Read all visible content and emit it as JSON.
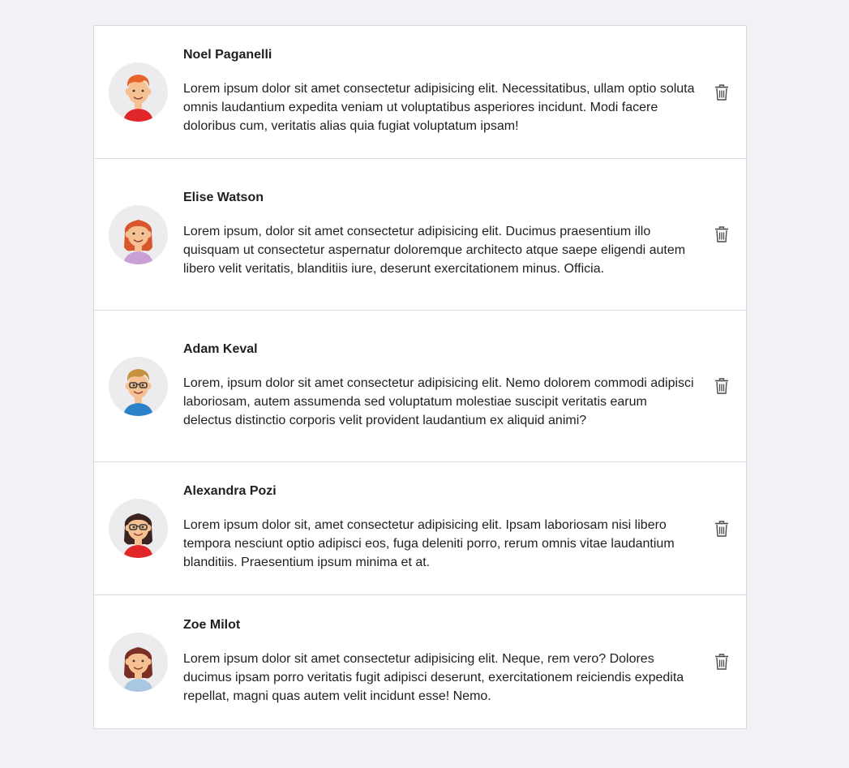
{
  "comments": [
    {
      "author": "Noel Paganelli",
      "text": "Lorem ipsum dolor sit amet consectetur adipisicing elit. Necessitatibus, ullam optio soluta omnis laudantium expedita veniam ut voluptatibus asperiores incidunt. Modi facere doloribus cum, veritatis alias quia fugiat voluptatum ipsam!",
      "avatar": {
        "hair": "#e8632b",
        "skin": "#f5c193",
        "shirt": "#e02628",
        "glasses": false,
        "long_hair": false
      }
    },
    {
      "author": "Elise Watson",
      "text": "Lorem ipsum, dolor sit amet consectetur adipisicing elit. Ducimus praesentium illo quisquam ut consectetur aspernatur doloremque architecto atque saepe eligendi autem libero velit veritatis, blanditiis iure, deserunt exercitationem minus. Officia.",
      "avatar": {
        "hair": "#d9552e",
        "skin": "#f5c193",
        "shirt": "#c89fd6",
        "glasses": false,
        "long_hair": true
      }
    },
    {
      "author": "Adam Keval",
      "text": "Lorem, ipsum dolor sit amet consectetur adipisicing elit. Nemo dolorem commodi adipisci laboriosam, autem assumenda sed voluptatum molestiae suscipit veritatis earum delectus distinctio corporis velit provident laudantium ex aliquid animi?",
      "avatar": {
        "hair": "#c8913f",
        "skin": "#f5c193",
        "shirt": "#2a82c9",
        "glasses": true,
        "long_hair": false
      }
    },
    {
      "author": "Alexandra Pozi",
      "text": "Lorem ipsum dolor sit, amet consectetur adipisicing elit. Ipsam laboriosam nisi libero tempora nesciunt optio adipisci eos, fuga deleniti porro, rerum omnis vitae laudantium blanditiis. Praesentium ipsum minima et at.",
      "avatar": {
        "hair": "#3b2320",
        "skin": "#f5c193",
        "shirt": "#e02628",
        "glasses": true,
        "long_hair": true
      }
    },
    {
      "author": "Zoe Milot",
      "text": "Lorem ipsum dolor sit amet consectetur adipisicing elit. Neque, rem vero? Dolores ducimus ipsam porro veritatis fugit adipisci deserunt, exercitationem reiciendis expedita repellat, magni quas autem velit incidunt esse! Nemo.",
      "avatar": {
        "hair": "#7a2e24",
        "skin": "#f5c193",
        "shirt": "#a9c7e3",
        "glasses": false,
        "long_hair": true
      }
    }
  ],
  "icons": {
    "delete": "trash-icon"
  },
  "colors": {
    "background": "#f1f2f6",
    "card": "#ffffff",
    "divider": "#dcdde2",
    "icon": "#4a4a4a"
  }
}
